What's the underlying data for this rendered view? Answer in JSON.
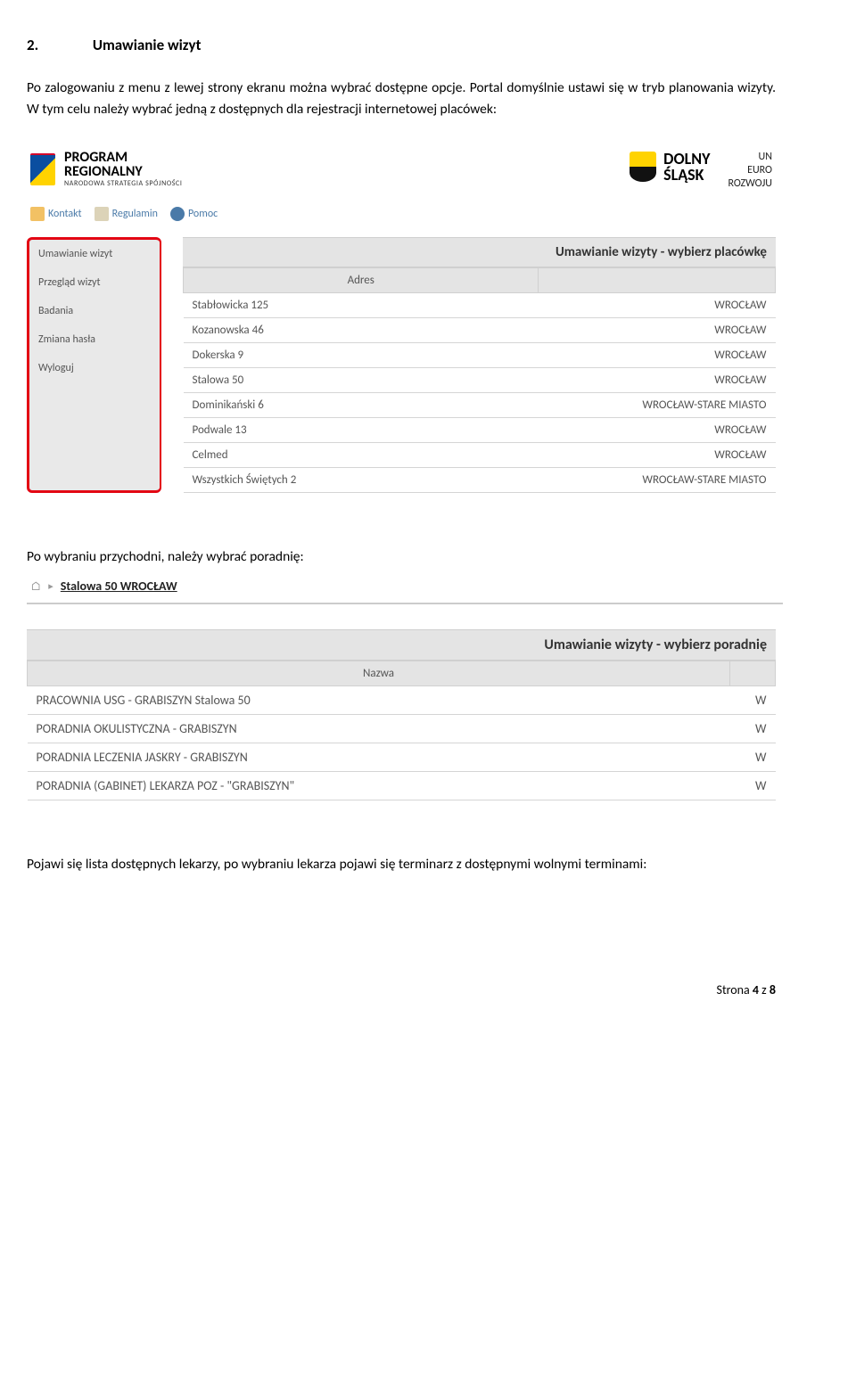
{
  "heading": {
    "num": "2.",
    "title": "Umawianie wizyt"
  },
  "paragraph1": "Po zalogowaniu z menu z lewej strony ekranu można wybrać dostępne opcje. Portal domyślnie ustawi się w tryb planowania wizyty. W tym celu należy wybrać jedną z dostępnych dla rejestracji internetowej placówek:",
  "logos": {
    "program": {
      "line1": "PROGRAM",
      "line2": "REGIONALNY",
      "line3": "NARODOWA STRATEGIA SPÓJNOŚCI"
    },
    "ds": {
      "line1": "DOLNY",
      "line2": "ŚLĄSK"
    },
    "rightcut": {
      "line1": "UN",
      "line2": "EURO",
      "line3": "ROZWOJU"
    }
  },
  "miniLinks": [
    {
      "label": "Kontakt",
      "icon": "envelope"
    },
    {
      "label": "Regulamin",
      "icon": "doc"
    },
    {
      "label": "Pomoc",
      "icon": "help"
    }
  ],
  "sidebar": {
    "items": [
      {
        "label": "Umawianie wizyt"
      },
      {
        "label": "Przegląd wizyt"
      },
      {
        "label": "Badania"
      },
      {
        "label": "Zmiana hasła"
      },
      {
        "label": "Wyloguj"
      }
    ]
  },
  "table1": {
    "sectionTitle": "Umawianie wizyty - wybierz placówkę",
    "headerAddress": "Adres",
    "rows": [
      {
        "addr": "Stabłowicka 125",
        "city": "WROCŁAW"
      },
      {
        "addr": "Kozanowska 46",
        "city": "WROCŁAW"
      },
      {
        "addr": "Dokerska 9",
        "city": "WROCŁAW"
      },
      {
        "addr": "Stalowa 50",
        "city": "WROCŁAW"
      },
      {
        "addr": "Dominikański 6",
        "city": "WROCŁAW-STARE MIASTO"
      },
      {
        "addr": "Podwale 13",
        "city": "WROCŁAW"
      },
      {
        "addr": "Celmed",
        "city": "WROCŁAW"
      },
      {
        "addr": "Wszystkich Świętych 2",
        "city": "WROCŁAW-STARE MIASTO"
      }
    ]
  },
  "paragraph2": "Po wybraniu przychodni, należy wybrać poradnię:",
  "breadcrumb": {
    "label": "Stalowa 50 WROCŁAW"
  },
  "table2": {
    "sectionTitle": "Umawianie wizyty - wybierz poradnię",
    "headerName": "Nazwa",
    "rows": [
      {
        "name": "PRACOWNIA USG - GRABISZYN Stalowa 50",
        "r": "W"
      },
      {
        "name": "PORADNIA OKULISTYCZNA - GRABISZYN",
        "r": "W"
      },
      {
        "name": "PORADNIA LECZENIA JASKRY - GRABISZYN",
        "r": "W"
      },
      {
        "name": "PORADNIA (GABINET) LEKARZA POZ - \"GRABISZYN\"",
        "r": "W"
      }
    ]
  },
  "paragraph3": "Pojawi się lista dostępnych lekarzy, po wybraniu lekarza pojawi się terminarz z dostępnymi wolnymi terminami:",
  "footer": {
    "prefix": "Strona ",
    "page": "4",
    "sep": " z ",
    "total": "8"
  }
}
